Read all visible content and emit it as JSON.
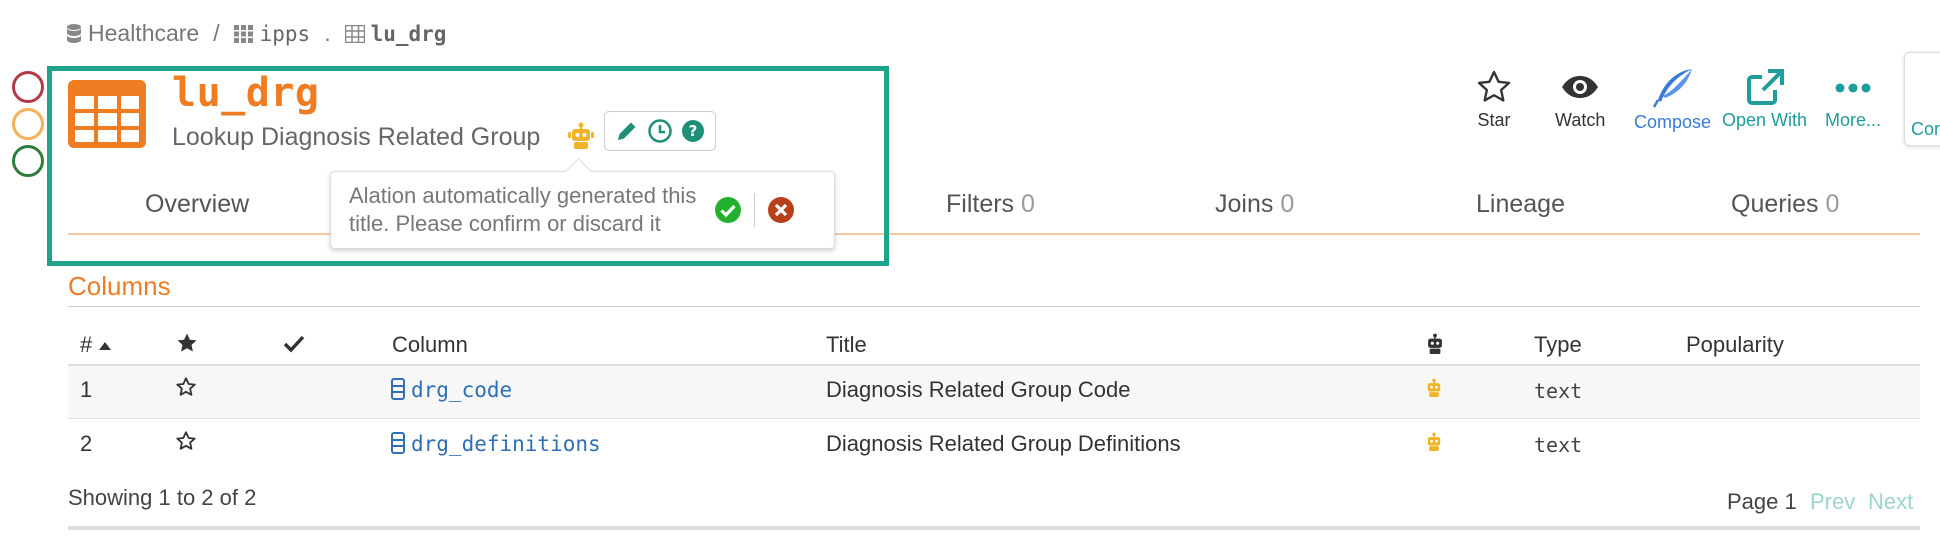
{
  "breadcrumb": {
    "database": "Healthcare",
    "separator": "/",
    "schema": "ipps",
    "dot": ".",
    "table": "lu_drg"
  },
  "header": {
    "title": "lu_drg",
    "subtitle": "Lookup Diagnosis Related Group"
  },
  "tooltip": {
    "text": "Alation automatically generated this title. Please confirm or discard it"
  },
  "tabs": [
    {
      "label": "Overview",
      "count": ""
    },
    {
      "label": "Filters",
      "count": "0"
    },
    {
      "label": "Joins",
      "count": "0"
    },
    {
      "label": "Lineage",
      "count": ""
    },
    {
      "label": "Queries",
      "count": "0"
    }
  ],
  "actions": {
    "star": "Star",
    "watch": "Watch",
    "compose": "Compose",
    "open_with": "Open With",
    "more": "More...",
    "side": "Cor"
  },
  "columns_section": {
    "title": "Columns",
    "headers": {
      "index": "#",
      "column": "Column",
      "title": "Title",
      "type": "Type",
      "popularity": "Popularity"
    },
    "rows": [
      {
        "index": "1",
        "column": "drg_code",
        "title": "Diagnosis Related Group Code",
        "type": "text"
      },
      {
        "index": "2",
        "column": "drg_definitions",
        "title": "Diagnosis Related Group Definitions",
        "type": "text"
      }
    ],
    "showing": "Showing 1 to 2 of 2",
    "page": "Page 1",
    "prev": "Prev",
    "next": "Next"
  },
  "colors": {
    "accent_orange": "#f07c22",
    "highlight_teal": "#1fa38a",
    "link_blue": "#2f6fb5",
    "robot_yellow": "#f0b429"
  },
  "icons": [
    "database-icon",
    "schema-grid-icon",
    "table-icon",
    "robot-icon",
    "pencil-icon",
    "history-icon",
    "help-icon",
    "confirm-check-icon",
    "discard-x-icon",
    "star-icon",
    "eye-icon",
    "feather-icon",
    "external-link-icon",
    "ellipsis-icon",
    "sort-asc-icon",
    "checkmark-icon",
    "column-icon"
  ]
}
